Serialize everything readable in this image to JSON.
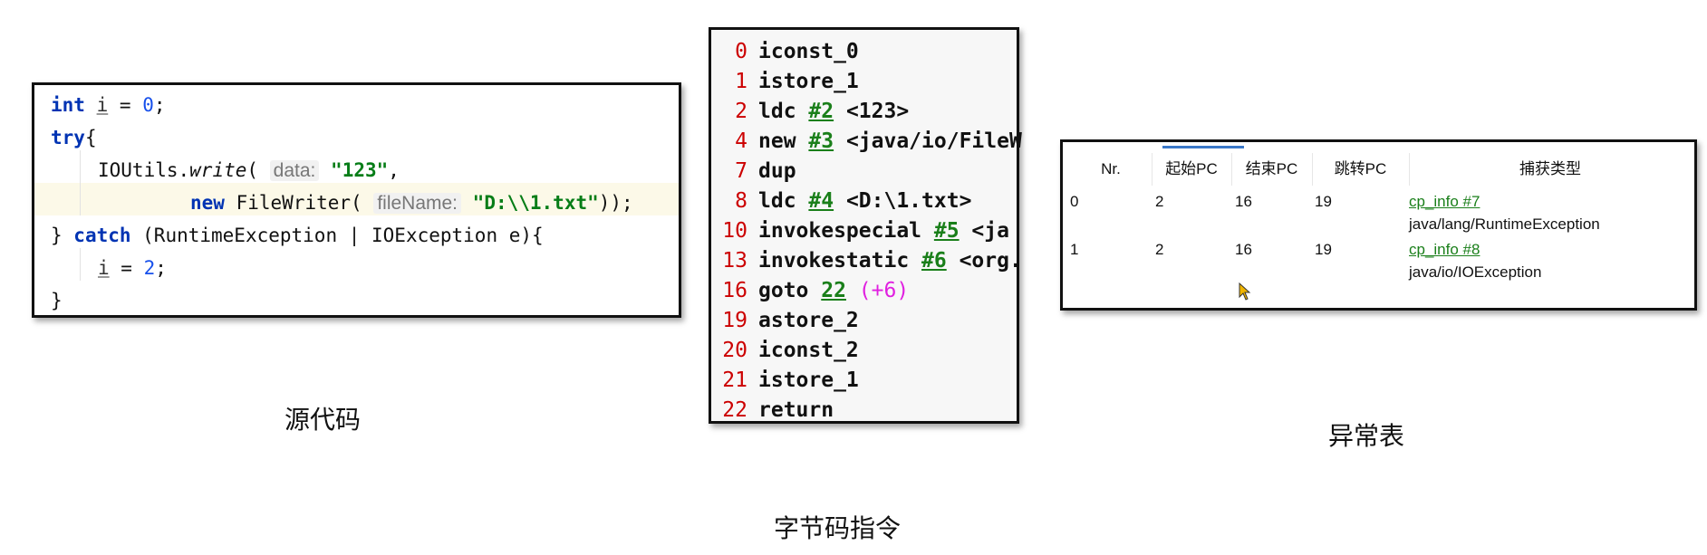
{
  "source": {
    "caption": "源代码",
    "lines": {
      "l1": {
        "kw": "int",
        "var": "i",
        "rest": " = ",
        "num": "0",
        "end": ";"
      },
      "l2": {
        "kw": "try",
        "end": "{"
      },
      "l3": {
        "pre": "IOUtils.",
        "method": "write",
        "paren": "( ",
        "hint": "data:",
        "str": "\"123\"",
        "end": ","
      },
      "l4": {
        "kw": "new",
        "mid": " FileWriter( ",
        "hint": "fileName:",
        "str": "\"D:\\\\1.txt\"",
        "end": "));"
      },
      "l5": {
        "pre": "} ",
        "kw": "catch",
        "rest": " (RuntimeException | IOException e){"
      },
      "l6": {
        "var": "i",
        "rest": " = ",
        "num": "2",
        "end": ";"
      },
      "l7": {
        "end": "}"
      }
    }
  },
  "bytecode": {
    "caption": "字节码指令",
    "lines": [
      {
        "pc": "0",
        "op": "iconst_0"
      },
      {
        "pc": "1",
        "op": "istore_1"
      },
      {
        "pc": "2",
        "op": "ldc ",
        "ref": "#2",
        "arg": " <123>"
      },
      {
        "pc": "4",
        "op": "new ",
        "ref": "#3",
        "arg": " <java/io/FileW"
      },
      {
        "pc": "7",
        "op": "dup"
      },
      {
        "pc": "8",
        "op": "ldc ",
        "ref": "#4",
        "arg": " <D:\\1.txt>"
      },
      {
        "pc": "10",
        "op": "invokespecial ",
        "ref": "#5",
        "arg": " <ja"
      },
      {
        "pc": "13",
        "op": "invokestatic ",
        "ref": "#6",
        "arg": " <org."
      },
      {
        "pc": "16",
        "op": "goto ",
        "ref": "22",
        "off": " (+6)"
      },
      {
        "pc": "19",
        "op": "astore_2"
      },
      {
        "pc": "20",
        "op": "iconst_2"
      },
      {
        "pc": "21",
        "op": "istore_1"
      },
      {
        "pc": "22",
        "op": "return"
      }
    ]
  },
  "exception_table": {
    "caption": "异常表",
    "headers": [
      "Nr.",
      "起始PC",
      "结束PC",
      "跳转PC",
      "捕获类型"
    ],
    "rows": [
      {
        "nr": "0",
        "start": "2",
        "end": "16",
        "handler": "19",
        "link": "cp_info #7",
        "type": "java/lang/RuntimeException"
      },
      {
        "nr": "1",
        "start": "2",
        "end": "16",
        "handler": "19",
        "link": "cp_info #8",
        "type": "java/io/IOException"
      }
    ]
  }
}
